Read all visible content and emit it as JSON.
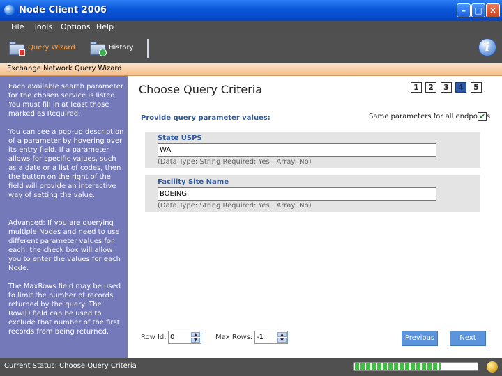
{
  "window": {
    "title": "Node Client 2006"
  },
  "menu": [
    {
      "label": "File",
      "key": "F"
    },
    {
      "label": "Tools",
      "key": "T"
    },
    {
      "label": "Options",
      "key": "O"
    },
    {
      "label": "Help",
      "key": "H"
    }
  ],
  "toolbar": {
    "query_wizard": "Query Wizard",
    "history": "History",
    "info_icon_glyph": "i"
  },
  "wizard": {
    "header": "Exchange Network Query Wizard"
  },
  "help": [
    "Each available search parameter for the chosen service is listed. You must fill in at least those marked as Required.",
    "You can see a pop-up description of a parameter by hovering over its entry field. If a parameter allows for specific values, such as a date or a list of codes, then the button on the right of the field will provide an interactive way of setting the value.",
    "Advanced: If you are querying multiple Nodes and need to use different parameter values for each, the check box will allow you to enter the values for each Node.",
    "The MaxRows field may be used to limit the number of records returned by the query. The RowID field can be used to exclude that number of the first records from being returned."
  ],
  "main": {
    "title": "Choose Query Criteria",
    "steps": [
      "1",
      "2",
      "3",
      "4",
      "5"
    ],
    "active_step": "4",
    "subtitle": "Provide query parameter values:",
    "same_params_label": "Same parameters for all endpoints",
    "same_params_checked": true,
    "params": [
      {
        "name": "State USPS",
        "value": "WA",
        "info": "(Data Type: String   Required: Yes | Array: No)"
      },
      {
        "name": "Facility Site Name",
        "value": "BOEING",
        "info": "(Data Type: String   Required: Yes | Array: No)"
      }
    ],
    "row_id_label": "Row Id:",
    "row_id_value": "0",
    "max_rows_label": "Max Rows:",
    "max_rows_value": "-1",
    "previous_label": "Previous",
    "next_label": "Next"
  },
  "status": {
    "text": "Current Status:  Choose Query Criteria",
    "progress_fraction": 0.7
  },
  "colors": {
    "accent": "#2c5aa6",
    "help_pane": "#7479ba",
    "wizard_header": "#f4be8a",
    "button": "#5b94da"
  }
}
